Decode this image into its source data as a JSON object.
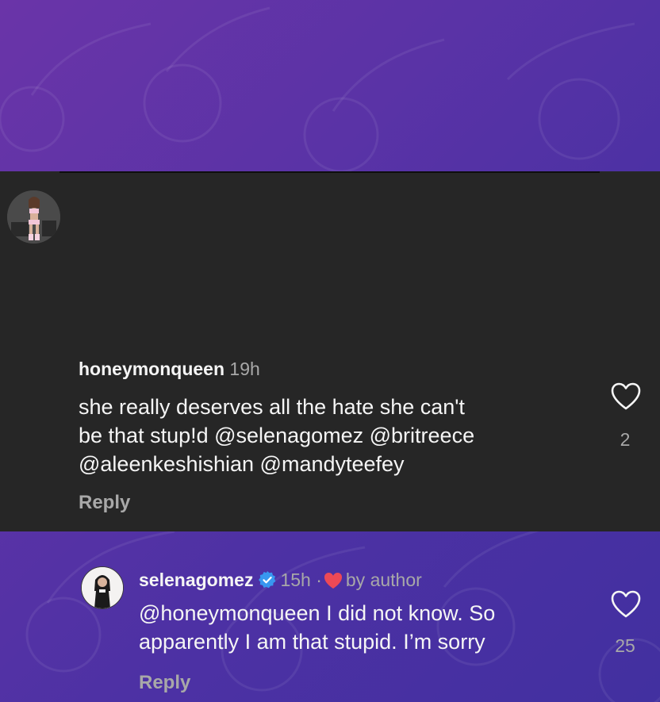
{
  "comments": [
    {
      "username": "honeymonqueen",
      "time": "19h",
      "lines": [
        "she really deserves all the hate she can't",
        "be that stup!d @selenagomez @britreece",
        "@aleenkeshishian @mandyteefey"
      ],
      "reply_label": "Reply",
      "like_count": "2"
    },
    {
      "username": "selenagomez",
      "time": "15h",
      "separator": "·",
      "liked_by": "by author",
      "lines": [
        "@honeymonqueen I did not know. So",
        "apparently I am that stupid. I’m sorry"
      ],
      "reply_label": "Reply",
      "like_count": "25"
    }
  ],
  "colors": {
    "panel": "#262626",
    "text": "#f5f5f5",
    "secondary": "#a8a8a8",
    "verified": "#3897f0",
    "heart": "#ed4956",
    "background_purple": "#5a33a6"
  }
}
